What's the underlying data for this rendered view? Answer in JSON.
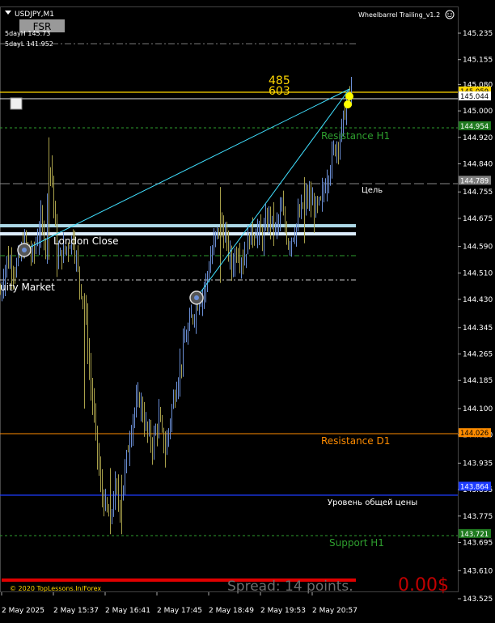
{
  "header": {
    "symbol": "USDJPY,M1",
    "fsr_button": "FSR",
    "day_high": "5dayH 145.73",
    "day_low": "5dayL 141.952",
    "indicator_title": "Wheelbarrel Trailing_v1.2"
  },
  "annotations": {
    "top_num_1": "485",
    "top_num_2": "603",
    "resistance_h1": "Resistance H1",
    "target": "Цель",
    "london_close": "London Close",
    "equity_market": "uity Market",
    "resistance_d1": "Resistance D1",
    "common_price": "Уровень общей цены",
    "support_h1": "Support H1"
  },
  "footer": {
    "copyright": "© 2020 TopLessons.In/Forex",
    "spread": "Spread: 14 points.",
    "profit": "0.00$"
  },
  "price_axis": {
    "ticks": [
      "145.235",
      "145.155",
      "145.080",
      "145.000",
      "144.920",
      "144.840",
      "144.755",
      "144.675",
      "144.590",
      "144.510",
      "144.430",
      "144.345",
      "144.265",
      "144.185",
      "144.100",
      "144.020",
      "143.935",
      "143.855",
      "143.775",
      "143.695",
      "143.610",
      "143.525"
    ],
    "labels": [
      {
        "text": "145.059",
        "price": 145.059,
        "color": "#ffd700",
        "fg": "#000"
      },
      {
        "text": "145.044",
        "price": 145.044,
        "color": "#ffffff",
        "fg": "#000"
      },
      {
        "text": "144.954",
        "price": 144.954,
        "color": "#1f7a1f",
        "fg": "#fff"
      },
      {
        "text": "144.789",
        "price": 144.789,
        "color": "#808080",
        "fg": "#fff"
      },
      {
        "text": "144.026",
        "price": 144.026,
        "color": "#ff8c00",
        "fg": "#000"
      },
      {
        "text": "143.864",
        "price": 143.864,
        "color": "#1e3cff",
        "fg": "#fff"
      },
      {
        "text": "143.721",
        "price": 143.721,
        "color": "#1f7a1f",
        "fg": "#fff"
      }
    ]
  },
  "time_axis": {
    "ticks": [
      "2 May 2025",
      "2 May 15:37",
      "2 May 16:41",
      "2 May 17:45",
      "2 May 18:49",
      "2 May 19:53",
      "2 May 20:57"
    ]
  },
  "colors": {
    "bull": "#6b8fd6",
    "bear": "#a8a04a",
    "resistance_h1": "#2e9e2e",
    "resistance_d1": "#ff8c00",
    "common_price": "#1e3cff",
    "yellow": "#ffd700",
    "fib_line": "#40e0ff",
    "zone": "#add8e6",
    "spread_text": "#6e6e6e",
    "profit": "#c00000"
  },
  "chart_data": {
    "type": "candlestick",
    "symbol": "USDJPY",
    "timeframe": "M1",
    "ylim": [
      143.525,
      145.3
    ],
    "close_path": [
      {
        "x": 0,
        "y": 144.45
      },
      {
        "x": 8,
        "y": 144.55
      },
      {
        "x": 18,
        "y": 144.52
      },
      {
        "x": 30,
        "y": 144.6
      },
      {
        "x": 40,
        "y": 144.56
      },
      {
        "x": 50,
        "y": 144.66
      },
      {
        "x": 56,
        "y": 144.6
      },
      {
        "x": 60,
        "y": 144.85
      },
      {
        "x": 64,
        "y": 144.8
      },
      {
        "x": 70,
        "y": 144.55
      },
      {
        "x": 80,
        "y": 144.58
      },
      {
        "x": 90,
        "y": 144.62
      },
      {
        "x": 98,
        "y": 144.48
      },
      {
        "x": 104,
        "y": 144.42
      },
      {
        "x": 110,
        "y": 144.22
      },
      {
        "x": 118,
        "y": 144.02
      },
      {
        "x": 124,
        "y": 143.86
      },
      {
        "x": 130,
        "y": 143.8
      },
      {
        "x": 136,
        "y": 143.76
      },
      {
        "x": 142,
        "y": 143.86
      },
      {
        "x": 148,
        "y": 143.8
      },
      {
        "x": 156,
        "y": 143.95
      },
      {
        "x": 164,
        "y": 144.08
      },
      {
        "x": 172,
        "y": 144.13
      },
      {
        "x": 180,
        "y": 144.04
      },
      {
        "x": 188,
        "y": 143.99
      },
      {
        "x": 196,
        "y": 144.07
      },
      {
        "x": 204,
        "y": 143.97
      },
      {
        "x": 212,
        "y": 144.1
      },
      {
        "x": 220,
        "y": 144.2
      },
      {
        "x": 228,
        "y": 144.3
      },
      {
        "x": 236,
        "y": 144.37
      },
      {
        "x": 244,
        "y": 144.42
      },
      {
        "x": 252,
        "y": 144.46
      },
      {
        "x": 260,
        "y": 144.55
      },
      {
        "x": 266,
        "y": 144.62
      },
      {
        "x": 272,
        "y": 144.66
      },
      {
        "x": 280,
        "y": 144.6
      },
      {
        "x": 286,
        "y": 144.53
      },
      {
        "x": 292,
        "y": 144.58
      },
      {
        "x": 300,
        "y": 144.55
      },
      {
        "x": 308,
        "y": 144.62
      },
      {
        "x": 316,
        "y": 144.64
      },
      {
        "x": 324,
        "y": 144.62
      },
      {
        "x": 332,
        "y": 144.68
      },
      {
        "x": 340,
        "y": 144.64
      },
      {
        "x": 348,
        "y": 144.7
      },
      {
        "x": 356,
        "y": 144.6
      },
      {
        "x": 364,
        "y": 144.64
      },
      {
        "x": 372,
        "y": 144.7
      },
      {
        "x": 380,
        "y": 144.74
      },
      {
        "x": 388,
        "y": 144.7
      },
      {
        "x": 396,
        "y": 144.72
      },
      {
        "x": 404,
        "y": 144.8
      },
      {
        "x": 412,
        "y": 144.88
      },
      {
        "x": 420,
        "y": 144.92
      },
      {
        "x": 426,
        "y": 145.0
      },
      {
        "x": 432,
        "y": 145.05
      }
    ],
    "levels": [
      {
        "name": "yellow-top",
        "price": 145.059
      },
      {
        "name": "white-line",
        "price": 145.044
      },
      {
        "name": "resistance-h1",
        "price": 144.954
      },
      {
        "name": "target",
        "price": 144.789
      },
      {
        "name": "zone-top",
        "price": 144.66
      },
      {
        "name": "zone-bottom",
        "price": 144.64
      },
      {
        "name": "resistance-d1",
        "price": 144.026
      },
      {
        "name": "common-price",
        "price": 143.864
      },
      {
        "name": "support-h1",
        "price": 143.721
      }
    ]
  }
}
